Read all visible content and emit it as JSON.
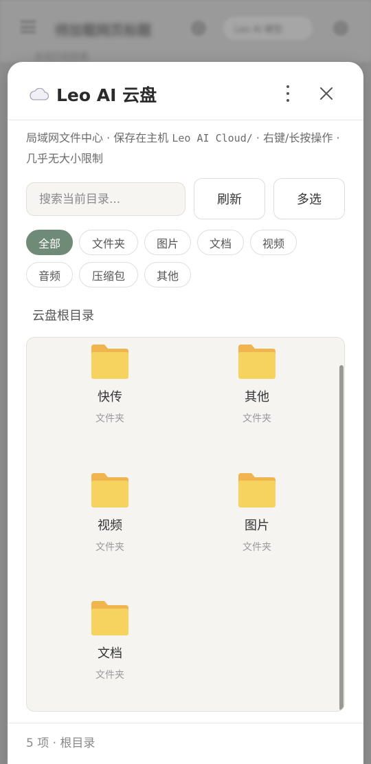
{
  "background": {
    "title": "待加载网页标题",
    "subtitle": "会话已经就绪",
    "pill_label": "Leo AI 模型"
  },
  "modal": {
    "title": "Leo AI 云盘",
    "icons": {
      "app": "cloud-icon",
      "more": "more-vertical-icon",
      "close": "close-icon"
    },
    "description_parts": [
      "局域网文件中心 · 保存在主机 ",
      "Leo AI Cloud/",
      " · 右键/长按操作 · 几乎无大小限制"
    ],
    "search": {
      "placeholder": "搜索当前目录...",
      "value": ""
    },
    "buttons": {
      "refresh": "刷新",
      "multi_select": "多选"
    },
    "filters": [
      {
        "label": "全部",
        "active": true
      },
      {
        "label": "文件夹",
        "active": false
      },
      {
        "label": "图片",
        "active": false
      },
      {
        "label": "文档",
        "active": false
      },
      {
        "label": "视频",
        "active": false
      },
      {
        "label": "音频",
        "active": false
      },
      {
        "label": "压缩包",
        "active": false
      },
      {
        "label": "其他",
        "active": false
      }
    ],
    "breadcrumb": "云盘根目录",
    "items": [
      {
        "name": "快传",
        "type": "文件夹",
        "icon": "folder-icon"
      },
      {
        "name": "其他",
        "type": "文件夹",
        "icon": "folder-icon"
      },
      {
        "name": "视频",
        "type": "文件夹",
        "icon": "folder-icon"
      },
      {
        "name": "图片",
        "type": "文件夹",
        "icon": "folder-icon"
      },
      {
        "name": "文档",
        "type": "文件夹",
        "icon": "folder-icon"
      }
    ],
    "footer": "5 项 · 根目录",
    "colors": {
      "accent": "#6f8a76",
      "folder": "#f6d35e",
      "folder_tab": "#f0b54e"
    }
  }
}
